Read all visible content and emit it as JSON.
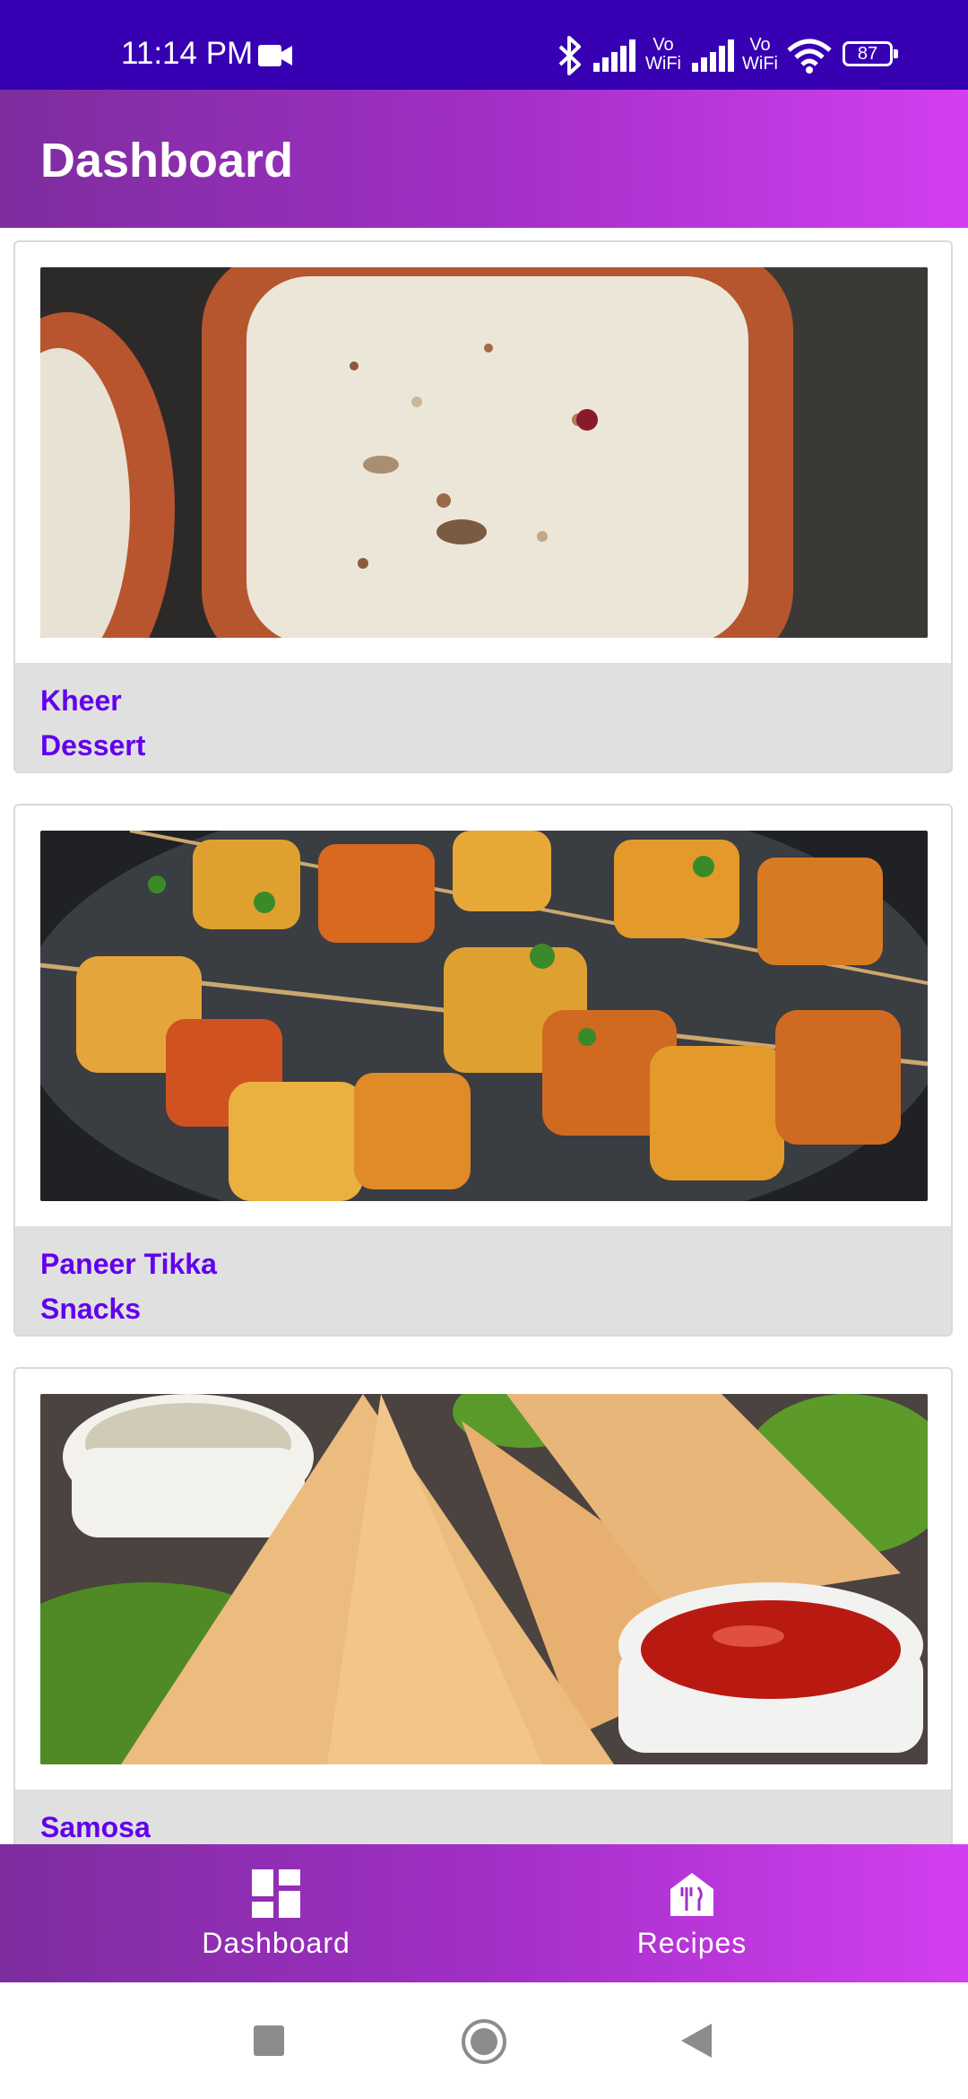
{
  "status_bar": {
    "time": "11:14 PM",
    "battery": "87",
    "icons": [
      "video-camera-icon",
      "bluetooth-icon",
      "signal-icon",
      "vowifi-icon",
      "signal-icon",
      "vowifi-icon",
      "wifi-icon",
      "battery-icon"
    ],
    "vowifi_label_top": "Vo",
    "vowifi_label_bottom": "WiFi"
  },
  "app_bar": {
    "title": "Dashboard"
  },
  "recipes": [
    {
      "name": "Kheer",
      "category": "Dessert"
    },
    {
      "name": "Paneer Tikka",
      "category": "Snacks"
    },
    {
      "name": "Samosa",
      "category": ""
    }
  ],
  "bottom_nav": {
    "items": [
      {
        "label": "Dashboard",
        "icon": "dashboard-icon"
      },
      {
        "label": "Recipes",
        "icon": "restaurant-icon"
      }
    ]
  },
  "system_nav": {
    "icons": [
      "recent-apps-icon",
      "home-icon",
      "back-icon"
    ]
  },
  "colors": {
    "status_bar": "#3700b3",
    "gradient_start": "#7d2d9e",
    "gradient_end": "#d33ff0",
    "accent_text": "#6200ee",
    "card_footer": "#e0e0e0"
  }
}
